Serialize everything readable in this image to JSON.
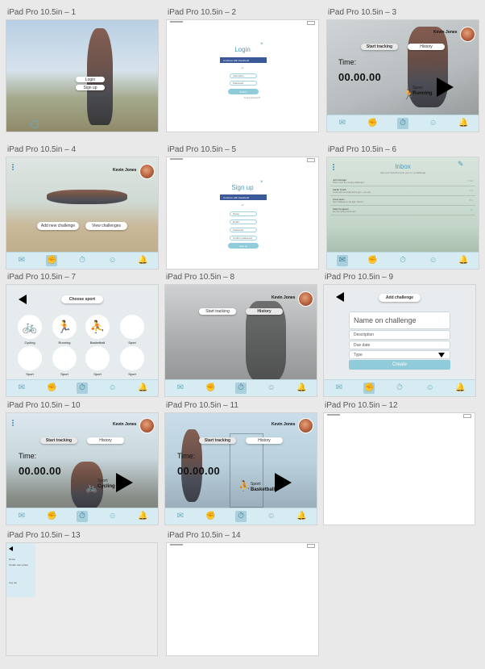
{
  "artboards": {
    "a1": {
      "label": "iPad Pro 10.5in – 1",
      "login": "Login",
      "signup": "Sign up"
    },
    "a2": {
      "label": "iPad Pro 10.5in – 2",
      "title": "Login",
      "close": "×",
      "facebook": "Continue with Facebook",
      "or": "or",
      "username": "Username",
      "password": "Password",
      "submit": "Submit",
      "forgot": "Forgot password?"
    },
    "a3": {
      "label": "iPad Pro 10.5in – 3",
      "user": "Kevin Jones",
      "start": "Start tracking",
      "history": "History",
      "time_label": "Time:",
      "time": "00.00.00",
      "sport_label": "Sport:",
      "sport": "Running"
    },
    "a4": {
      "label": "iPad Pro 10.5in – 4",
      "user": "Kevin Jones",
      "add": "Add new challenge",
      "view": "View challenges"
    },
    "a5": {
      "label": "iPad Pro 10.5in – 5",
      "title": "Sign up",
      "close": "×",
      "facebook": "Continue with Facebook",
      "or": "or",
      "name": "Name",
      "email": "Email",
      "password": "Password",
      "confirm": "Confirm password",
      "submit": "Sign up"
    },
    "a6": {
      "label": "iPad Pro 10.5in – 6",
      "title": "Inbox",
      "subtitle": "Ask your friends to join you on a challenge",
      "rows": [
        {
          "sender": "John Rodger",
          "preview": "Want to join the running challenge?",
          "when": "2 min"
        },
        {
          "sender": "Sarah Smith",
          "preview": "Great work out today at the gym – see you",
          "when": "1 hr"
        },
        {
          "sender": "Crew team",
          "preview": "New challenge in the app, check it",
          "when": "3 hr"
        },
        {
          "sender": "Kelly Ferguson",
          "preview": "Are we cycling tomorrow?",
          "when": "1 d"
        }
      ]
    },
    "a7": {
      "label": "iPad Pro 10.5in – 7",
      "title": "Choose sport",
      "sports": [
        "Cycling",
        "Running",
        "Basketball",
        "Sport",
        "Sport",
        "Sport",
        "Sport",
        "Sport"
      ]
    },
    "a8": {
      "label": "iPad Pro 10.5in – 8",
      "user": "Kevin Jones",
      "start": "Start tracking",
      "history": "History"
    },
    "a9": {
      "label": "iPad Pro 10.5in – 9",
      "title": "Add challenge",
      "name": "Name on challenge",
      "description": "Description",
      "due": "Due date",
      "type": "Type",
      "create": "Create"
    },
    "a10": {
      "label": "iPad Pro 10.5in – 10",
      "user": "Kevin Jones",
      "start": "Start tracking",
      "history": "History",
      "time_label": "Time:",
      "time": "00.00.00",
      "sport_label": "Sport:",
      "sport": "Cycling"
    },
    "a11": {
      "label": "iPad Pro 10.5in – 11",
      "user": "Kevin Jones",
      "start": "Start tracking",
      "history": "History",
      "time_label": "Time:",
      "time": "00.00.00",
      "sport_label": "Sport:",
      "sport": "Basketball"
    },
    "a12": {
      "label": "iPad Pro 10.5in – 12"
    },
    "a13": {
      "label": "iPad Pro 10.5in – 13",
      "menu": [
        "Home",
        "Create new group",
        "Log out"
      ]
    },
    "a14": {
      "label": "iPad Pro 10.5in – 14"
    }
  },
  "tab_icons": [
    "mail-icon",
    "fist-icon",
    "stopwatch-icon",
    "profile-icon",
    "bell-icon"
  ],
  "colors": {
    "accent": "#4a9bbd",
    "tabbar": "#d7ecf2",
    "tab_active": "#a9cfdc",
    "facebook": "#3b5998"
  }
}
